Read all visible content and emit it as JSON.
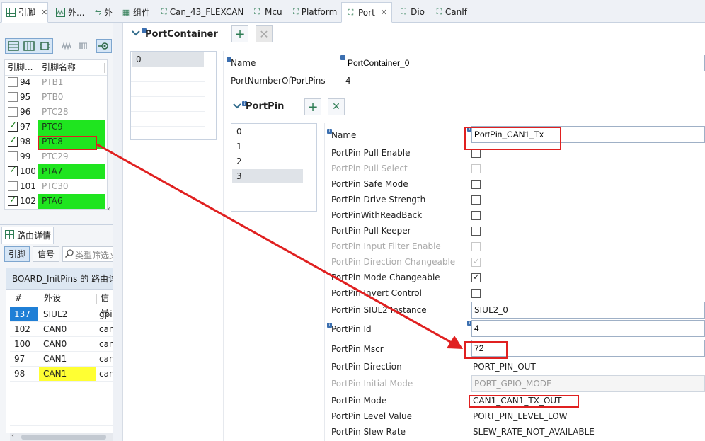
{
  "left_tabs": [
    {
      "icon": "grid-table-icon",
      "label": "引脚"
    },
    {
      "icon": "waveform-icon",
      "label": "外..."
    },
    {
      "icon": "signal-icon",
      "label": "外"
    }
  ],
  "editor_tabs": [
    {
      "icon": "component-icon",
      "label": "组件",
      "active": false
    },
    {
      "icon": "config-file-icon",
      "label": "Can_43_FLEXCAN",
      "active": false
    },
    {
      "icon": "config-file-icon",
      "label": "Mcu",
      "active": false
    },
    {
      "icon": "config-file-icon",
      "label": "Platform",
      "active": false
    },
    {
      "icon": "config-file-icon",
      "label": "Port",
      "active": true
    },
    {
      "icon": "config-file-icon",
      "label": "Dio",
      "active": false
    },
    {
      "icon": "config-file-icon",
      "label": "CanIf",
      "active": false
    }
  ],
  "pins_table": {
    "headers": [
      "引脚...",
      "引脚名称",
      "I"
    ],
    "rows": [
      {
        "num": "94",
        "name": "PTB1",
        "checked": false,
        "routed": false
      },
      {
        "num": "95",
        "name": "PTB0",
        "checked": false,
        "routed": false
      },
      {
        "num": "96",
        "name": "PTC28",
        "checked": false,
        "routed": false
      },
      {
        "num": "97",
        "name": "PTC9",
        "checked": true,
        "routed": true
      },
      {
        "num": "98",
        "name": "PTC8",
        "checked": true,
        "routed": true
      },
      {
        "num": "99",
        "name": "PTC29",
        "checked": false,
        "routed": false
      },
      {
        "num": "100",
        "name": "PTA7",
        "checked": true,
        "routed": true
      },
      {
        "num": "101",
        "name": "PTC30",
        "checked": false,
        "routed": false
      },
      {
        "num": "102",
        "name": "PTA6",
        "checked": true,
        "routed": true
      }
    ]
  },
  "routing": {
    "title": "路由详情",
    "btn_pin": "引脚",
    "btn_signal": "信号",
    "filter_placeholder": "类型筛选文",
    "group_title": "BOARD_InitPins 的 路由详",
    "headers": [
      "#",
      "外设",
      "信号"
    ],
    "rows": [
      {
        "num": "137",
        "peripheral": "SIUL2",
        "signal": "gpi"
      },
      {
        "num": "102",
        "peripheral": "CAN0",
        "signal": "can"
      },
      {
        "num": "100",
        "peripheral": "CAN0",
        "signal": "can"
      },
      {
        "num": "97",
        "peripheral": "CAN1",
        "signal": "can"
      },
      {
        "num": "98",
        "peripheral": "CAN1",
        "signal": "can"
      }
    ]
  },
  "port_container": {
    "section_title": "PortContainer",
    "list": [
      "0"
    ],
    "name_label": "Name",
    "name_value": "PortContainer_0",
    "num_pins_label": "PortNumberOfPortPins",
    "num_pins_value": "4"
  },
  "port_pin": {
    "section_title": "PortPin",
    "list": [
      "0",
      "1",
      "2",
      "3"
    ],
    "selected": "3",
    "name_label": "Name",
    "name_value": "PortPin_CAN1_Tx",
    "checks": [
      {
        "label": "PortPin Pull Enable",
        "checked": false,
        "enabled": true
      },
      {
        "label": "PortPin Pull Select",
        "checked": false,
        "enabled": false
      },
      {
        "label": "PortPin Safe Mode",
        "checked": false,
        "enabled": true
      },
      {
        "label": "PortPin Drive Strength",
        "checked": false,
        "enabled": true
      },
      {
        "label": "PortPinWithReadBack",
        "checked": false,
        "enabled": true
      },
      {
        "label": "PortPin Pull Keeper",
        "checked": false,
        "enabled": true
      },
      {
        "label": "PortPin Input Filter Enable",
        "checked": false,
        "enabled": false
      },
      {
        "label": "PortPin Direction Changeable",
        "checked": true,
        "enabled": false
      },
      {
        "label": "PortPin Mode Changeable",
        "checked": true,
        "enabled": true
      },
      {
        "label": "PortPin Invert Control",
        "checked": false,
        "enabled": true
      }
    ],
    "siul2_label": "PortPin SIUL2 Instance",
    "siul2_value": "SIUL2_0",
    "id_label": "PortPin Id",
    "id_value": "4",
    "mscr_label": "PortPin Mscr",
    "mscr_value": "72",
    "direction_label": "PortPin Direction",
    "direction_value": "PORT_PIN_OUT",
    "initial_mode_label": "PortPin Initial Mode",
    "initial_mode_value": "PORT_GPIO_MODE",
    "mode_label": "PortPin Mode",
    "mode_value": "CAN1_CAN1_TX_OUT",
    "level_label": "PortPin Level Value",
    "level_value": "PORT_PIN_LEVEL_LOW",
    "slew_label": "PortPin Slew Rate",
    "slew_value": "SLEW_RATE_NOT_AVAILABLE"
  },
  "colors": {
    "routed_green": "#1fe51f",
    "highlight_yellow": "#ffff33",
    "selected_blue": "#1f7fd6",
    "annotation_red": "#e02020"
  }
}
